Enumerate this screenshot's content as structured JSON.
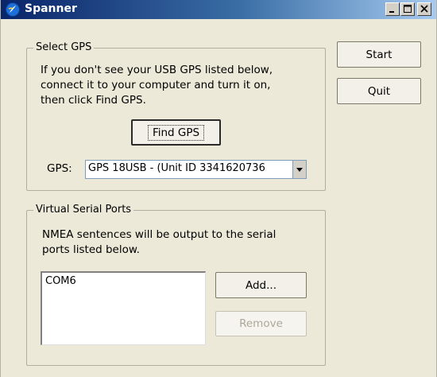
{
  "window": {
    "title": "Spanner"
  },
  "select_gps": {
    "group_label": "Select GPS",
    "instructions": [
      "If you don't see your USB GPS listed below,",
      "connect it to your computer and turn it on,",
      "then click Find GPS."
    ],
    "find_button": "Find GPS",
    "gps_label": "GPS:",
    "gps_selected": "GPS 18USB - (Unit ID 3341620736"
  },
  "actions": {
    "start": "Start",
    "quit": "Quit"
  },
  "virtual_ports": {
    "group_label": "Virtual Serial Ports",
    "description": [
      "NMEA sentences will be output to the serial",
      "ports listed below."
    ],
    "ports": [
      "COM6"
    ],
    "add_button": "Add...",
    "remove_button": "Remove"
  },
  "icons": {
    "app": "spanner-logo-icon",
    "minimize": "minimize-icon",
    "maximize": "maximize-icon",
    "close": "close-icon",
    "dropdown": "chevron-down-icon"
  },
  "colors": {
    "titlebar_start": "#0a246a",
    "titlebar_end": "#a6caf0",
    "dialog_bg": "#ece9d8"
  }
}
